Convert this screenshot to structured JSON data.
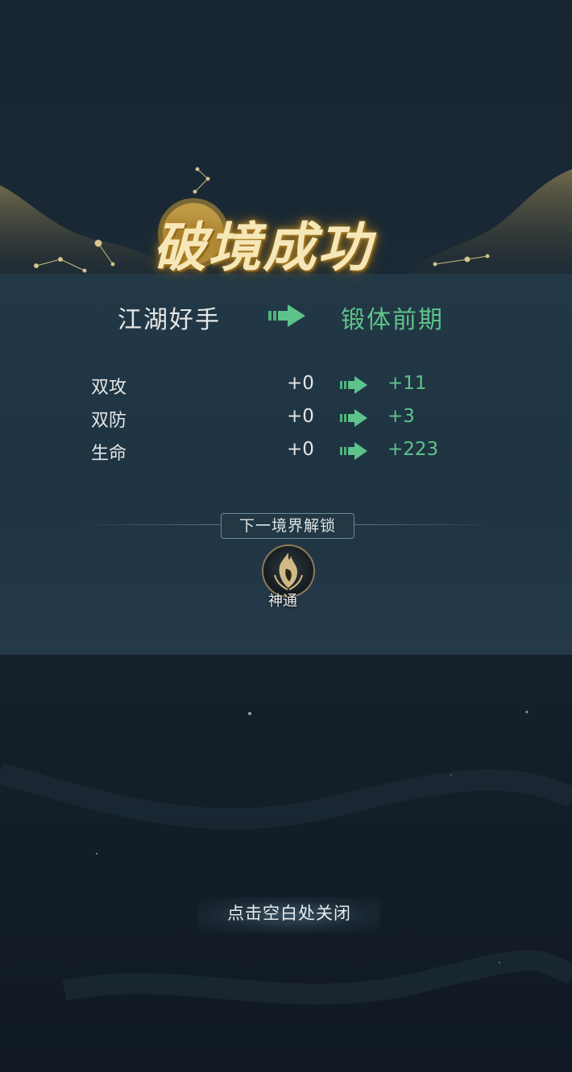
{
  "title": "破境成功",
  "realm": {
    "from": "江湖好手",
    "to": "锻体前期"
  },
  "stats": [
    {
      "label": "双攻",
      "old": "+0",
      "new": "+11"
    },
    {
      "label": "双防",
      "old": "+0",
      "new": "+3"
    },
    {
      "label": "生命",
      "old": "+0",
      "new": "+223"
    }
  ],
  "unlock": {
    "label": "下一境界解锁",
    "skill_name": "神通",
    "skill_icon": "flame-spirit-icon"
  },
  "close_hint": "点击空白处关闭",
  "colors": {
    "gain": "#5ec38a",
    "gold": "#f6e7b8",
    "panel": "#223846"
  }
}
